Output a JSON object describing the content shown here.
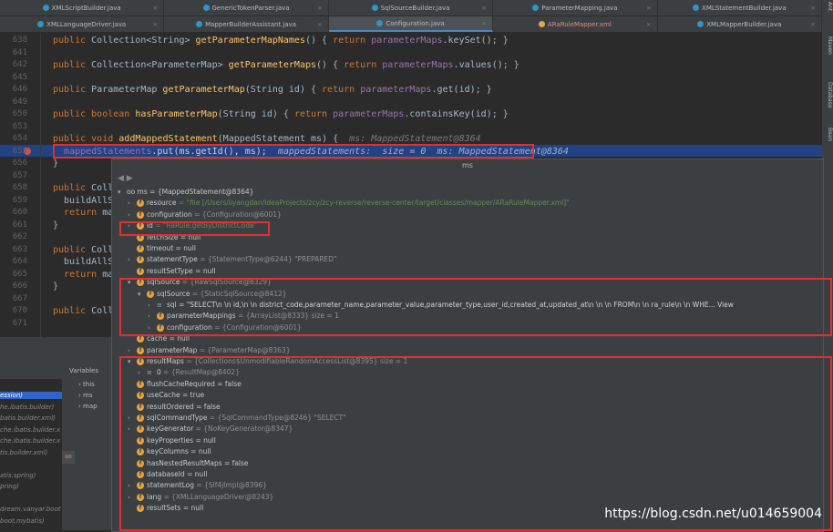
{
  "tabs_row1": [
    {
      "label": "XMLScriptBuilder.java",
      "active": false
    },
    {
      "label": "GenericTokenParser.java",
      "active": false
    },
    {
      "label": "SqlSourceBuilder.java",
      "active": false
    },
    {
      "label": "ParameterMapping.java",
      "active": false
    },
    {
      "label": "XMLStatementBuilder.java",
      "active": false
    }
  ],
  "tabs_row2": [
    {
      "label": "XMLLanguageDriver.java",
      "active": false
    },
    {
      "label": "MapperBuilderAssistant.java",
      "active": false
    },
    {
      "label": "Configuration.java",
      "active": true
    },
    {
      "label": "ARaRuleMapper.xml",
      "active": false
    },
    {
      "label": "XMLMapperBuilder.java",
      "active": false
    }
  ],
  "right_strip": [
    "Ant",
    "Maven",
    "Database",
    "Bean"
  ],
  "editor": {
    "lines": [
      {
        "num": "638",
        "code": "public Collection<String> getParameterMapNames() { return parameterMaps.keySet(); }"
      },
      {
        "num": "641",
        "code": ""
      },
      {
        "num": "642",
        "code": "public Collection<ParameterMap> getParameterMaps() { return parameterMaps.values(); }"
      },
      {
        "num": "645",
        "code": ""
      },
      {
        "num": "646",
        "code": "public ParameterMap getParameterMap(String id) { return parameterMaps.get(id); }"
      },
      {
        "num": "649",
        "code": ""
      },
      {
        "num": "650",
        "code": "public boolean hasParameterMap(String id) { return parameterMaps.containsKey(id); }"
      },
      {
        "num": "653",
        "code": ""
      },
      {
        "num": "654",
        "code": "public void addMappedStatement(MappedStatement ms) {"
      },
      {
        "num": "655",
        "code": "  mappedStatements.put(ms.getId(), ms);"
      },
      {
        "num": "656",
        "code": "}"
      },
      {
        "num": "657",
        "code": ""
      },
      {
        "num": "658",
        "code": "public Colle"
      },
      {
        "num": "659",
        "code": "  buildAllSt"
      },
      {
        "num": "660",
        "code": "  return map"
      },
      {
        "num": "661",
        "code": "}"
      },
      {
        "num": "662",
        "code": ""
      },
      {
        "num": "663",
        "code": "public Colle"
      },
      {
        "num": "664",
        "code": "  buildAllSt"
      },
      {
        "num": "665",
        "code": "  return map"
      },
      {
        "num": "666",
        "code": "}"
      },
      {
        "num": "667",
        "code": ""
      },
      {
        "num": "670",
        "code": "public Colle"
      },
      {
        "num": "671",
        "code": ""
      }
    ],
    "hint_654": "ms: MappedStatement@8364",
    "hint_655": "mappedStatements:  size = 0  ms: MappedStatement@8364"
  },
  "popup": {
    "title": "ms",
    "rows": [
      {
        "indent": 0,
        "arrow": "▾",
        "icon": "oo",
        "text": "oo ms = {MappedStatement@8364}"
      },
      {
        "indent": 1,
        "arrow": "›",
        "icon": "f",
        "name": "resource",
        "value": "= \"file [/Users/liyangdan/IdeaProjects/zcy/zcy-reverse/reverse-center/target/classes/mapper/ARaRuleMapper.xml]\"",
        "vclass": "str"
      },
      {
        "indent": 1,
        "arrow": "›",
        "icon": "f",
        "name": "configuration",
        "value": "= {Configuration@6001}",
        "vclass": "tp"
      },
      {
        "indent": 1,
        "arrow": "›",
        "icon": "f",
        "name": "id",
        "value": "= \"RaRule.getByDistrictCode\"",
        "vclass": "str"
      },
      {
        "indent": 1,
        "arrow": "",
        "icon": "f",
        "name": "fetchSize",
        "value": "= null",
        "vclass": "nm"
      },
      {
        "indent": 1,
        "arrow": "",
        "icon": "f",
        "name": "timeout",
        "value": "= null",
        "vclass": "nm"
      },
      {
        "indent": 1,
        "arrow": "›",
        "icon": "f",
        "name": "statementType",
        "value": "= {StatementType@6244} \"PREPARED\"",
        "vclass": "tp"
      },
      {
        "indent": 1,
        "arrow": "",
        "icon": "f",
        "name": "resultSetType",
        "value": "= null",
        "vclass": "nm"
      },
      {
        "indent": 1,
        "arrow": "▾",
        "icon": "f",
        "name": "sqlSource",
        "value": "= {RawSqlSource@8329}",
        "vclass": "tp"
      },
      {
        "indent": 2,
        "arrow": "▾",
        "icon": "f",
        "name": "sqlSource",
        "value": "= {StaticSqlSource@8412}",
        "vclass": "tp"
      },
      {
        "indent": 3,
        "arrow": "›",
        "icon": "l",
        "name": "sql",
        "value": "= \"SELECT\\n      \\n      id,\\n      \\n      district_code,parameter_name,parameter_value,parameter_type,user_id,created_at,updated_at\\n    \\n    \\n      FROM\\n      \\n      ra_rule\\n      \\n      WHE...  View",
        "vclass": "strp"
      },
      {
        "indent": 3,
        "arrow": "›",
        "icon": "f",
        "name": "parameterMappings",
        "value": "= {ArrayList@8333}  size = 1",
        "vclass": "tp"
      },
      {
        "indent": 3,
        "arrow": "›",
        "icon": "f",
        "name": "configuration",
        "value": "= {Configuration@6001}",
        "vclass": "tp"
      },
      {
        "indent": 1,
        "arrow": "",
        "icon": "f",
        "name": "cache",
        "value": "= null",
        "vclass": "nm"
      },
      {
        "indent": 1,
        "arrow": "›",
        "icon": "f",
        "name": "parameterMap",
        "value": "= {ParameterMap@8363}",
        "vclass": "tp"
      },
      {
        "indent": 1,
        "arrow": "▾",
        "icon": "f",
        "name": "resultMaps",
        "value": "= {Collections$UnmodifiableRandomAccessList@8395}  size = 1",
        "vclass": "tp"
      },
      {
        "indent": 2,
        "arrow": "›",
        "icon": "l",
        "name": "0",
        "value": "= {ResultMap@8402}",
        "vclass": "tp"
      },
      {
        "indent": 1,
        "arrow": "",
        "icon": "f",
        "name": "flushCacheRequired",
        "value": "= false",
        "vclass": "nm"
      },
      {
        "indent": 1,
        "arrow": "",
        "icon": "f",
        "name": "useCache",
        "value": "= true",
        "vclass": "nm"
      },
      {
        "indent": 1,
        "arrow": "",
        "icon": "f",
        "name": "resultOrdered",
        "value": "= false",
        "vclass": "nm"
      },
      {
        "indent": 1,
        "arrow": "›",
        "icon": "f",
        "name": "sqlCommandType",
        "value": "= {SqlCommandType@8246} \"SELECT\"",
        "vclass": "tp"
      },
      {
        "indent": 1,
        "arrow": "›",
        "icon": "f",
        "name": "keyGenerator",
        "value": "= {NoKeyGenerator@8347}",
        "vclass": "tp"
      },
      {
        "indent": 1,
        "arrow": "",
        "icon": "f",
        "name": "keyProperties",
        "value": "= null",
        "vclass": "nm"
      },
      {
        "indent": 1,
        "arrow": "",
        "icon": "f",
        "name": "keyColumns",
        "value": "= null",
        "vclass": "nm"
      },
      {
        "indent": 1,
        "arrow": "",
        "icon": "f",
        "name": "hasNestedResultMaps",
        "value": "= false",
        "vclass": "nm"
      },
      {
        "indent": 1,
        "arrow": "",
        "icon": "f",
        "name": "databaseId",
        "value": "= null",
        "vclass": "nm"
      },
      {
        "indent": 1,
        "arrow": "›",
        "icon": "f",
        "name": "statementLog",
        "value": "= {Slf4jImpl@8396}",
        "vclass": "tp"
      },
      {
        "indent": 1,
        "arrow": "›",
        "icon": "f",
        "name": "lang",
        "value": "= {XMLLanguageDriver@8243}",
        "vclass": "tp"
      },
      {
        "indent": 1,
        "arrow": "",
        "icon": "f",
        "name": "resultSets",
        "value": "= null",
        "vclass": "nm"
      }
    ]
  },
  "debugger": {
    "variables_label": "Variables",
    "frames": [
      "ession)",
      "he.ibatis.builder)",
      "batis.builder.xml)",
      "che.ibatis.builder.x",
      "che.ibatis.builder.x",
      "tis.builder.xml)",
      "",
      "atis.spring)",
      "pring)",
      "",
      "dream.vanyar.boot",
      "boot.mybatis)"
    ],
    "vars": [
      "this",
      "ms",
      "map"
    ],
    "oo_label": "oo"
  },
  "watermark": "https://blog.csdn.net/u014659004",
  "colors": {
    "accent": "#2f65ca",
    "current_line": "#214283",
    "annotation_red": "#e03030",
    "field_icon": "#e8a33d"
  }
}
